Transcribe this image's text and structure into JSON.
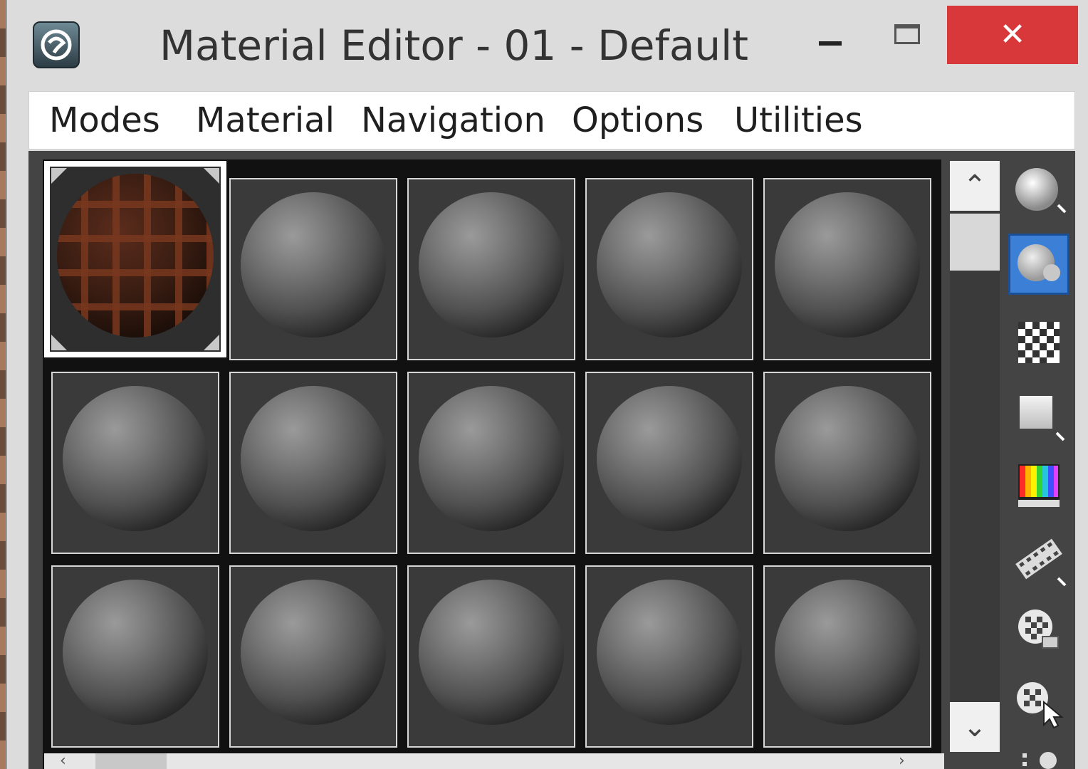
{
  "window": {
    "title": "Material Editor - 01 - Default",
    "close_glyph": "✕",
    "accent_close": "#d9383a",
    "accent_selected": "#3b7fd6"
  },
  "menu": {
    "items": [
      "Modes",
      "Material",
      "Navigation",
      "Options",
      "Utilities"
    ]
  },
  "sample_slots": {
    "rows": 3,
    "columns": 5,
    "active_slot": 0,
    "active_material": "brown-lattice-texture",
    "default_material": "gray-sphere"
  },
  "scrollbar": {
    "up_glyph": "⌃",
    "down_glyph": "⌄",
    "left_glyph": "‹",
    "right_glyph": "›"
  },
  "toolbar": {
    "icons": [
      "sample-type-sphere-icon",
      "backlight-icon",
      "background-checker-icon",
      "sample-uv-tiling-icon",
      "video-color-check-icon",
      "make-preview-icon",
      "options-icon",
      "select-by-material-icon",
      "material-navigator-icon"
    ],
    "selected_index": 1
  }
}
